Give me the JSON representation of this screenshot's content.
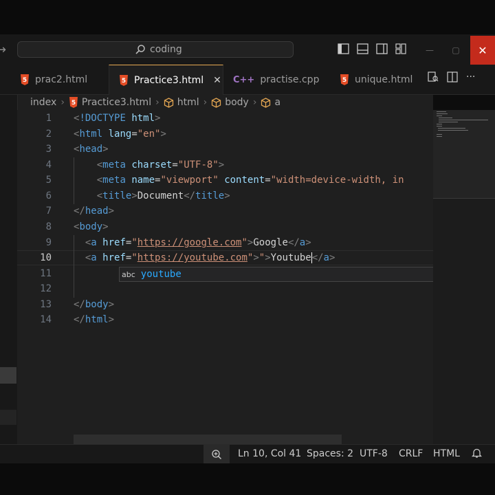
{
  "command_center": {
    "text": "coding"
  },
  "tabs": [
    {
      "label": "prac2.html",
      "type": "html"
    },
    {
      "label": "Practice3.html",
      "type": "html",
      "active": true
    },
    {
      "label": "practise.cpp",
      "type": "cpp"
    },
    {
      "label": "unique.html",
      "type": "html"
    }
  ],
  "breadcrumb": {
    "root": "index",
    "file": "Practice3.html",
    "items": [
      "html",
      "body",
      "a"
    ]
  },
  "gutter": [
    "1",
    "2",
    "3",
    "4",
    "5",
    "6",
    "7",
    "8",
    "9",
    "10",
    "11",
    "12",
    "13",
    "14"
  ],
  "code": {
    "l4_charset": "\"UTF-8\"",
    "l5_content": "\"width=device-width, in",
    "l6_text": "Document",
    "l9_href": "https://google.com",
    "l9_text": "Google",
    "l10_href": "https://youtube.com",
    "l10_text": "Youtube"
  },
  "suggestion": {
    "kind": "abc",
    "text": "youtube"
  },
  "statusbar": {
    "position": "Ln 10, Col 41",
    "spaces": "Spaces: 2",
    "encoding": "UTF-8",
    "eol": "CRLF",
    "language": "HTML"
  },
  "colors": {
    "tag": "#569cd6",
    "attr": "#9cdcfe",
    "string": "#ce9178",
    "html_icon": "#e44d26",
    "cpp_icon": "#a074c4",
    "close_button": "#c42b1c"
  }
}
